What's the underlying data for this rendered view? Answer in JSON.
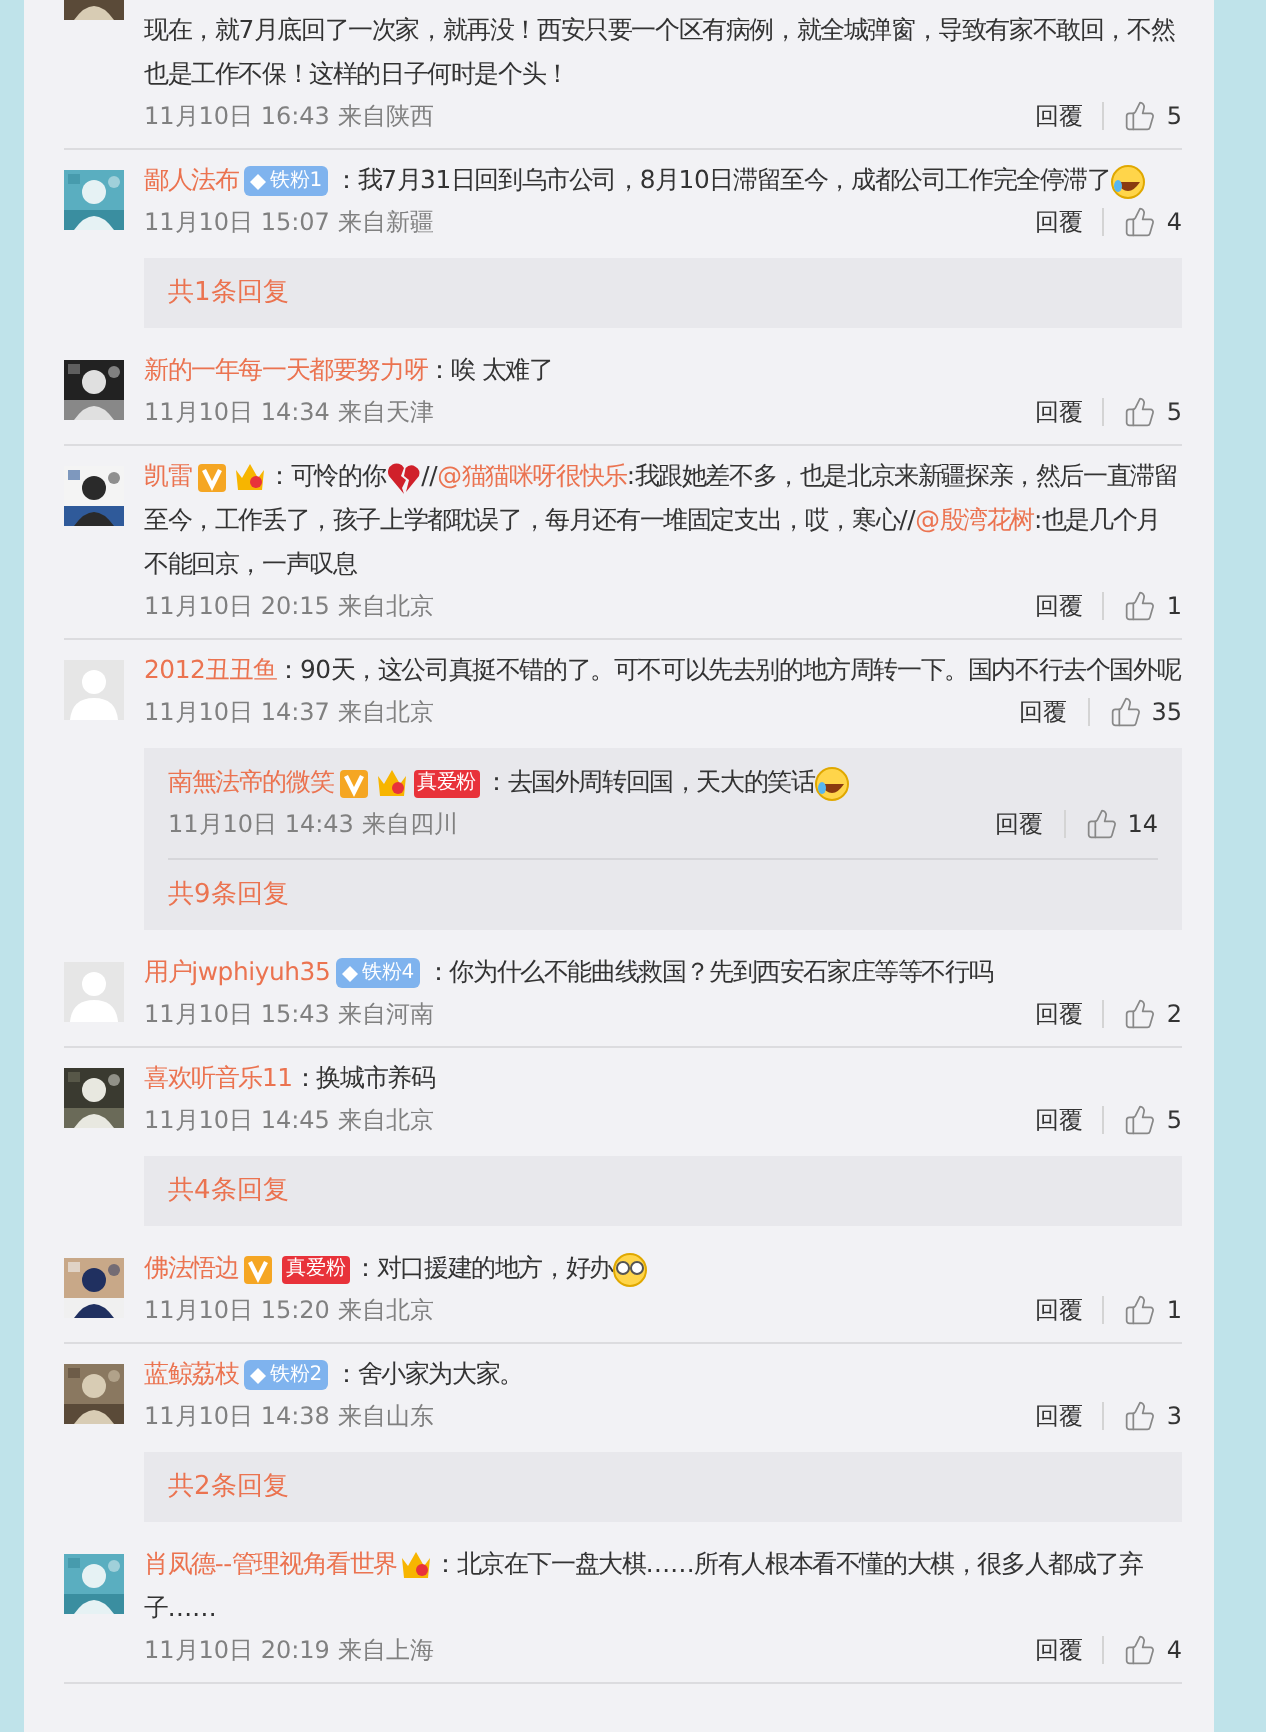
{
  "comments": [
    {
      "avatar": {
        "kind": "picture"
      },
      "segments": [
        {
          "kind": "text",
          "text": "现在，就7月底回了一次家，就再没！西安只要一个区有病例，就全城弹窗，导致有家不敢回，不然也是工作不保！这样的日子何时是个头！"
        }
      ],
      "time": "11月10日 16:43 来自陕西",
      "reply": "回覆",
      "likes": "5"
    },
    {
      "avatar": {
        "kind": "picture"
      },
      "name": "鄙人法布",
      "badges": [
        {
          "kind": "fan-level",
          "text": "铁粉1"
        }
      ],
      "segments": [
        {
          "kind": "text",
          "text": "：我7月31日回到乌市公司，8月10日滞留至今，成都公司工作完全停滞了"
        },
        {
          "kind": "emoji-laugh"
        }
      ],
      "time": "11月10日 15:07 来自新疆",
      "reply": "回覆",
      "likes": "4",
      "more_replies": "共1条回复"
    },
    {
      "avatar": {
        "kind": "picture"
      },
      "name": "新的一年每一天都要努力呀",
      "segments": [
        {
          "kind": "text",
          "text": "：唉 太难了"
        }
      ],
      "time": "11月10日 14:34 来自天津",
      "reply": "回覆",
      "likes": "5"
    },
    {
      "avatar": {
        "kind": "picture"
      },
      "name": "凯雷",
      "badges": [
        {
          "kind": "verified"
        },
        {
          "kind": "crown"
        }
      ],
      "segments": [
        {
          "kind": "text",
          "text": "：可怜的你"
        },
        {
          "kind": "emoji-heartbreak"
        },
        {
          "kind": "text",
          "text": "//"
        },
        {
          "kind": "mention",
          "text": "@猫猫咪呀很快乐"
        },
        {
          "kind": "text",
          "text": ":我跟她差不多，也是北京来新疆探亲，然后一直滞留至今，工作丢了，孩子上学都耽误了，每月还有一堆固定支出，哎，寒心//"
        },
        {
          "kind": "mention",
          "text": "@殷湾花树"
        },
        {
          "kind": "text",
          "text": ":也是几个月不能回京，一声叹息"
        }
      ],
      "time": "11月10日 20:15 来自北京",
      "reply": "回覆",
      "likes": "1"
    },
    {
      "avatar": {
        "kind": "default"
      },
      "name": "2012丑丑鱼",
      "segments": [
        {
          "kind": "text",
          "text": "：90天，这公司真挺不错的了。可不可以先去别的地方周转一下。国内不行去个国外呢"
        }
      ],
      "time": "11月10日 14:37 来自北京",
      "reply": "回覆",
      "likes": "35",
      "replies": [
        {
          "name": "南無法帝的微笑",
          "badges": [
            {
              "kind": "verified"
            },
            {
              "kind": "crown"
            },
            {
              "kind": "true-fan",
              "text": "真爱粉"
            }
          ],
          "segments": [
            {
              "kind": "text",
              "text": "：去国外周转回国，天大的笑话"
            },
            {
              "kind": "emoji-laugh"
            }
          ],
          "time": "11月10日 14:43 来自四川",
          "reply": "回覆",
          "likes": "14"
        }
      ],
      "more_replies": "共9条回复"
    },
    {
      "avatar": {
        "kind": "default"
      },
      "name": "用户jwphiyuh35",
      "badges": [
        {
          "kind": "fan-level",
          "text": "铁粉4"
        }
      ],
      "segments": [
        {
          "kind": "text",
          "text": "：你为什么不能曲线救国？先到西安石家庄等等不行吗"
        }
      ],
      "time": "11月10日 15:43 来自河南",
      "reply": "回覆",
      "likes": "2"
    },
    {
      "avatar": {
        "kind": "picture"
      },
      "name": "喜欢听音乐11",
      "segments": [
        {
          "kind": "text",
          "text": "：换城市养码"
        }
      ],
      "time": "11月10日 14:45 来自北京",
      "reply": "回覆",
      "likes": "5",
      "more_replies": "共4条回复"
    },
    {
      "avatar": {
        "kind": "picture"
      },
      "name": "佛法悟边",
      "badges": [
        {
          "kind": "verified"
        },
        {
          "kind": "true-fan",
          "text": "真爱粉"
        }
      ],
      "segments": [
        {
          "kind": "text",
          "text": "：对口援建的地方，好办"
        },
        {
          "kind": "emoji-glasses"
        }
      ],
      "time": "11月10日 15:20 来自北京",
      "reply": "回覆",
      "likes": "1"
    },
    {
      "avatar": {
        "kind": "picture"
      },
      "name": "蓝鲸荔枝",
      "badges": [
        {
          "kind": "fan-level",
          "text": "铁粉2"
        }
      ],
      "segments": [
        {
          "kind": "text",
          "text": "：舍小家为大家。"
        }
      ],
      "time": "11月10日 14:38 来自山东",
      "reply": "回覆",
      "likes": "3",
      "more_replies": "共2条回复"
    },
    {
      "avatar": {
        "kind": "picture"
      },
      "name": "肖凤德--管理视角看世界",
      "badges": [
        {
          "kind": "crown"
        }
      ],
      "segments": [
        {
          "kind": "text",
          "text": "：北京在下一盘大棋……所有人根本看不懂的大棋，很多人都成了弃子……"
        }
      ],
      "time": "11月10日 20:19 来自上海",
      "reply": "回覆",
      "likes": "4"
    }
  ]
}
